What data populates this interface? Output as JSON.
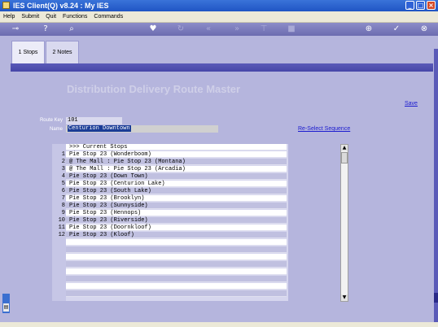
{
  "window": {
    "title": "IES Client(Q) v8.24 : My IES"
  },
  "menu": [
    "Help",
    "Submit",
    "Quit",
    "Functions",
    "Commands"
  ],
  "tabs": [
    {
      "label": "1 Stops",
      "active": true
    },
    {
      "label": "2 Notes",
      "active": false
    }
  ],
  "page": {
    "heading": "Distribution Delivery Route Master",
    "save_label": "Save",
    "reselect_label": "Re-Select Sequence"
  },
  "form": {
    "route_key_label": "Route Key",
    "route_key_value": "101",
    "name_label": "Name",
    "name_value": "Centurion Downtown"
  },
  "stops": {
    "header": ">>> Current Stops",
    "rows": [
      {
        "num": "1",
        "text": "Pie Stop 23 (Wonderboom)"
      },
      {
        "num": "2",
        "text": "@ The Mall : Pie Stop 23 (Montana)"
      },
      {
        "num": "3",
        "text": "@ The Mall : Pie Stop 23 (Arcadia)"
      },
      {
        "num": "4",
        "text": "Pie Stop 23 (Down Town)"
      },
      {
        "num": "5",
        "text": "Pie Stop 23 (Centurion Lake)"
      },
      {
        "num": "6",
        "text": "Pie Stop 23 (South Lake)"
      },
      {
        "num": "7",
        "text": "Pie Stop 23 (Brooklyn)"
      },
      {
        "num": "8",
        "text": "Pie Stop 23 (Sunnyside)"
      },
      {
        "num": "9",
        "text": "Pie Stop 23 (Hennops)"
      },
      {
        "num": "10",
        "text": "Pie Stop 23 (Riverside)"
      },
      {
        "num": "11",
        "text": "Pie Stop 23 (Doornkloof)"
      },
      {
        "num": "12",
        "text": "Pie Stop 23 (Kloof)"
      }
    ]
  },
  "colors": {
    "accent": "#5a5ab8",
    "background": "#b5b5dd",
    "link": "#1c1ccf",
    "title_bar": "#1f55c4"
  },
  "icons": [
    "key-icon",
    "help-icon",
    "search-icon",
    "heart-icon",
    "refresh-icon",
    "rewind-icon",
    "forward-icon",
    "up-icon",
    "stop-icon",
    "globe-icon",
    "check-icon",
    "close-icon"
  ]
}
